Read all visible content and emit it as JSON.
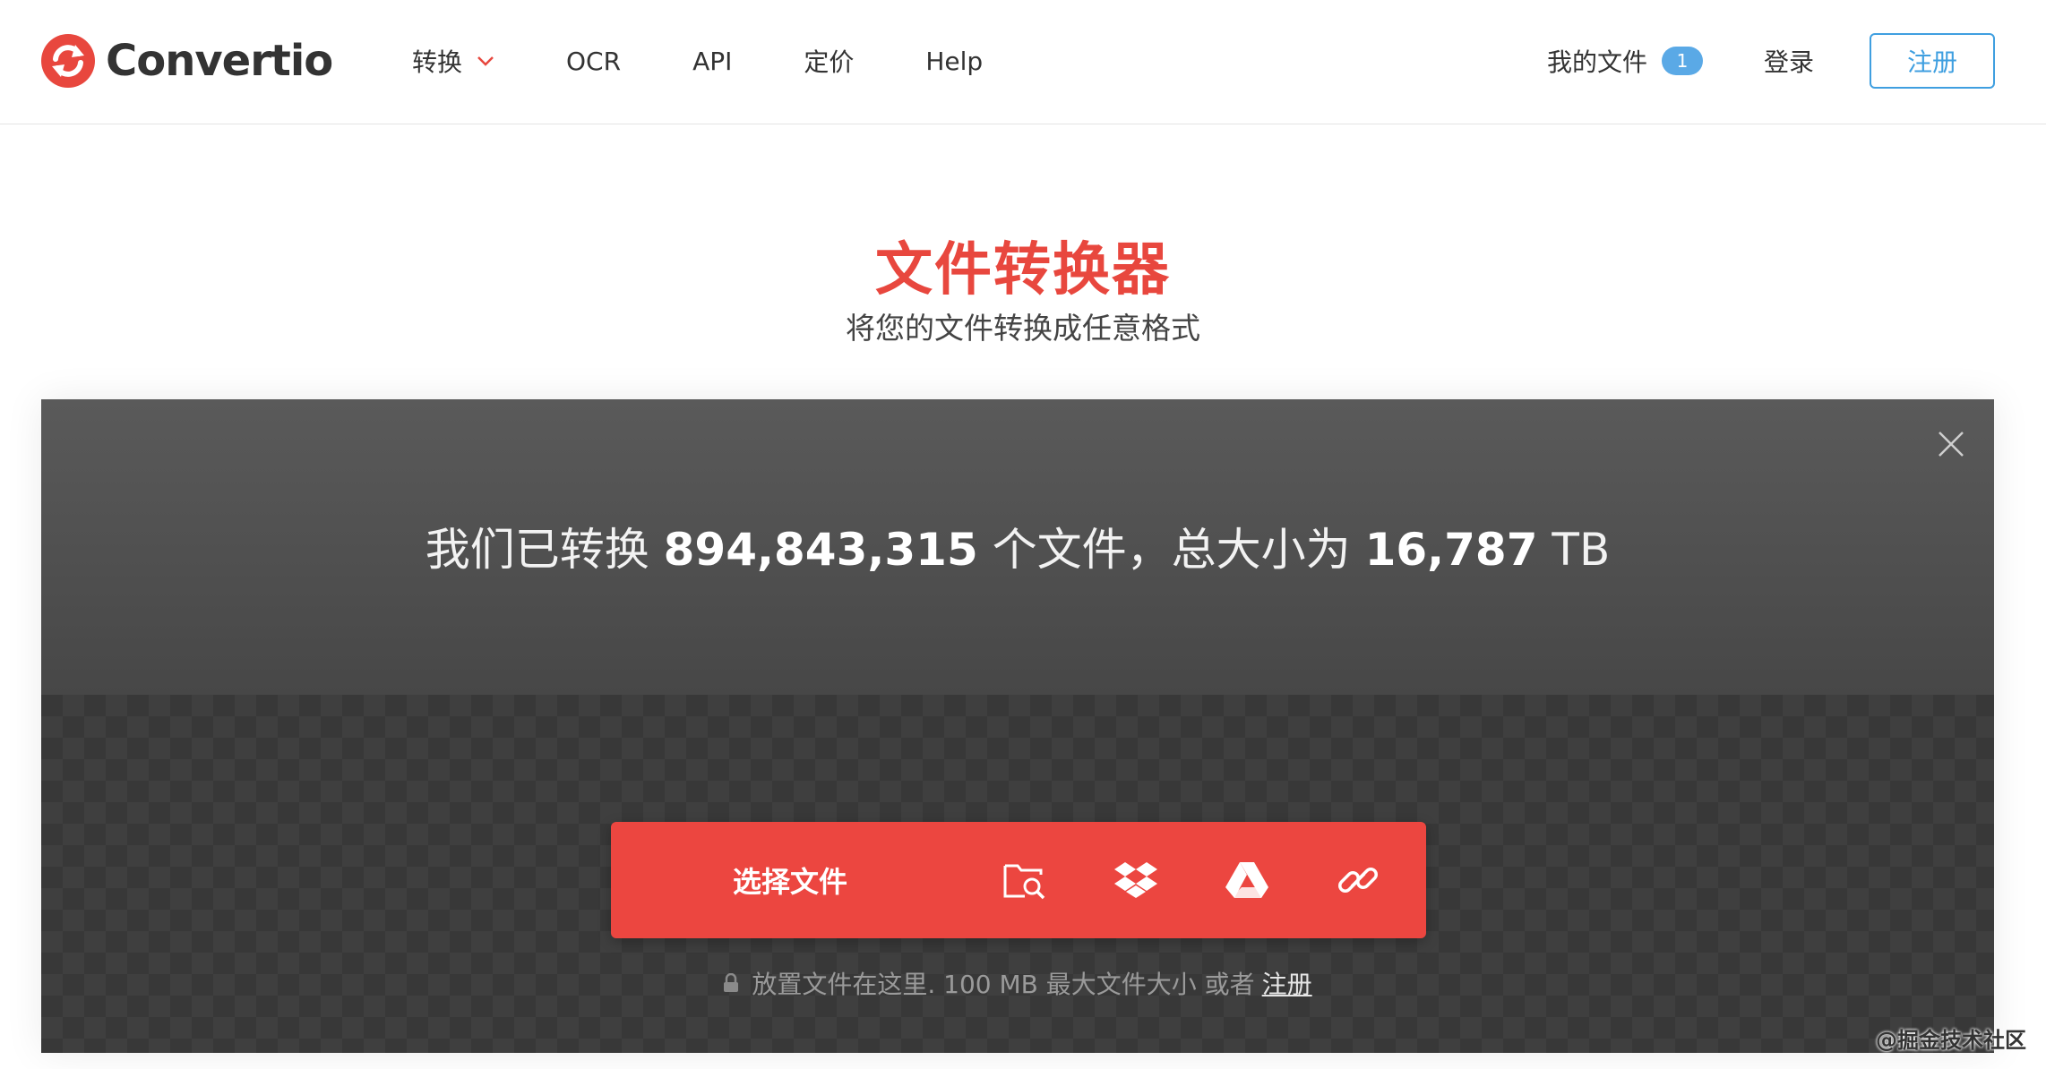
{
  "header": {
    "logo_text": "Convertio",
    "nav": [
      {
        "label": "转换",
        "has_dropdown": true
      },
      {
        "label": "OCR"
      },
      {
        "label": "API"
      },
      {
        "label": "定价"
      },
      {
        "label": "Help"
      }
    ],
    "my_files_label": "我的文件",
    "my_files_count": "1",
    "login_label": "登录",
    "signup_label": "注册"
  },
  "hero": {
    "title": "文件转换器",
    "subtitle": "将您的文件转换成任意格式"
  },
  "panel": {
    "stats_prefix": "我们已转换",
    "files_count": "894,843,315",
    "stats_middle": "个文件，总大小为",
    "total_size": "16,787",
    "size_unit": "TB",
    "choose_label": "选择文件",
    "sources": [
      "folder-search-icon",
      "dropbox-icon",
      "google-drive-icon",
      "url-link-icon"
    ],
    "drop_note": "放置文件在这里. 100 MB 最大文件大小 或者",
    "drop_note_link": "注册"
  },
  "watermark": "@掘金技术社区",
  "colors": {
    "brand_red": "#e8473e",
    "upload_red": "#ec4640",
    "signup_blue": "#3f9fe0",
    "badge_blue": "#5aa9e6",
    "panel_dark": "#3b3b3b"
  }
}
